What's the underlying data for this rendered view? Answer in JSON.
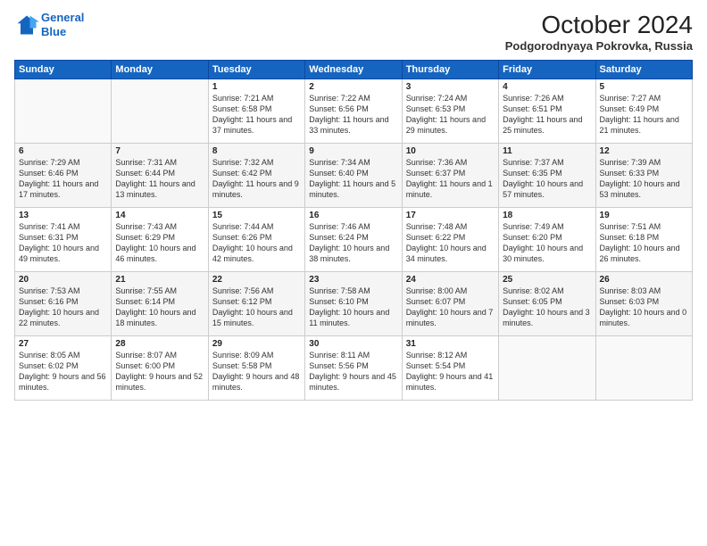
{
  "header": {
    "logo_line1": "General",
    "logo_line2": "Blue",
    "month_title": "October 2024",
    "location": "Podgorodnyaya Pokrovka, Russia"
  },
  "weekdays": [
    "Sunday",
    "Monday",
    "Tuesday",
    "Wednesday",
    "Thursday",
    "Friday",
    "Saturday"
  ],
  "weeks": [
    [
      {
        "day": "",
        "content": ""
      },
      {
        "day": "",
        "content": ""
      },
      {
        "day": "1",
        "content": "Sunrise: 7:21 AM\nSunset: 6:58 PM\nDaylight: 11 hours and 37 minutes."
      },
      {
        "day": "2",
        "content": "Sunrise: 7:22 AM\nSunset: 6:56 PM\nDaylight: 11 hours and 33 minutes."
      },
      {
        "day": "3",
        "content": "Sunrise: 7:24 AM\nSunset: 6:53 PM\nDaylight: 11 hours and 29 minutes."
      },
      {
        "day": "4",
        "content": "Sunrise: 7:26 AM\nSunset: 6:51 PM\nDaylight: 11 hours and 25 minutes."
      },
      {
        "day": "5",
        "content": "Sunrise: 7:27 AM\nSunset: 6:49 PM\nDaylight: 11 hours and 21 minutes."
      }
    ],
    [
      {
        "day": "6",
        "content": "Sunrise: 7:29 AM\nSunset: 6:46 PM\nDaylight: 11 hours and 17 minutes."
      },
      {
        "day": "7",
        "content": "Sunrise: 7:31 AM\nSunset: 6:44 PM\nDaylight: 11 hours and 13 minutes."
      },
      {
        "day": "8",
        "content": "Sunrise: 7:32 AM\nSunset: 6:42 PM\nDaylight: 11 hours and 9 minutes."
      },
      {
        "day": "9",
        "content": "Sunrise: 7:34 AM\nSunset: 6:40 PM\nDaylight: 11 hours and 5 minutes."
      },
      {
        "day": "10",
        "content": "Sunrise: 7:36 AM\nSunset: 6:37 PM\nDaylight: 11 hours and 1 minute."
      },
      {
        "day": "11",
        "content": "Sunrise: 7:37 AM\nSunset: 6:35 PM\nDaylight: 10 hours and 57 minutes."
      },
      {
        "day": "12",
        "content": "Sunrise: 7:39 AM\nSunset: 6:33 PM\nDaylight: 10 hours and 53 minutes."
      }
    ],
    [
      {
        "day": "13",
        "content": "Sunrise: 7:41 AM\nSunset: 6:31 PM\nDaylight: 10 hours and 49 minutes."
      },
      {
        "day": "14",
        "content": "Sunrise: 7:43 AM\nSunset: 6:29 PM\nDaylight: 10 hours and 46 minutes."
      },
      {
        "day": "15",
        "content": "Sunrise: 7:44 AM\nSunset: 6:26 PM\nDaylight: 10 hours and 42 minutes."
      },
      {
        "day": "16",
        "content": "Sunrise: 7:46 AM\nSunset: 6:24 PM\nDaylight: 10 hours and 38 minutes."
      },
      {
        "day": "17",
        "content": "Sunrise: 7:48 AM\nSunset: 6:22 PM\nDaylight: 10 hours and 34 minutes."
      },
      {
        "day": "18",
        "content": "Sunrise: 7:49 AM\nSunset: 6:20 PM\nDaylight: 10 hours and 30 minutes."
      },
      {
        "day": "19",
        "content": "Sunrise: 7:51 AM\nSunset: 6:18 PM\nDaylight: 10 hours and 26 minutes."
      }
    ],
    [
      {
        "day": "20",
        "content": "Sunrise: 7:53 AM\nSunset: 6:16 PM\nDaylight: 10 hours and 22 minutes."
      },
      {
        "day": "21",
        "content": "Sunrise: 7:55 AM\nSunset: 6:14 PM\nDaylight: 10 hours and 18 minutes."
      },
      {
        "day": "22",
        "content": "Sunrise: 7:56 AM\nSunset: 6:12 PM\nDaylight: 10 hours and 15 minutes."
      },
      {
        "day": "23",
        "content": "Sunrise: 7:58 AM\nSunset: 6:10 PM\nDaylight: 10 hours and 11 minutes."
      },
      {
        "day": "24",
        "content": "Sunrise: 8:00 AM\nSunset: 6:07 PM\nDaylight: 10 hours and 7 minutes."
      },
      {
        "day": "25",
        "content": "Sunrise: 8:02 AM\nSunset: 6:05 PM\nDaylight: 10 hours and 3 minutes."
      },
      {
        "day": "26",
        "content": "Sunrise: 8:03 AM\nSunset: 6:03 PM\nDaylight: 10 hours and 0 minutes."
      }
    ],
    [
      {
        "day": "27",
        "content": "Sunrise: 8:05 AM\nSunset: 6:02 PM\nDaylight: 9 hours and 56 minutes."
      },
      {
        "day": "28",
        "content": "Sunrise: 8:07 AM\nSunset: 6:00 PM\nDaylight: 9 hours and 52 minutes."
      },
      {
        "day": "29",
        "content": "Sunrise: 8:09 AM\nSunset: 5:58 PM\nDaylight: 9 hours and 48 minutes."
      },
      {
        "day": "30",
        "content": "Sunrise: 8:11 AM\nSunset: 5:56 PM\nDaylight: 9 hours and 45 minutes."
      },
      {
        "day": "31",
        "content": "Sunrise: 8:12 AM\nSunset: 5:54 PM\nDaylight: 9 hours and 41 minutes."
      },
      {
        "day": "",
        "content": ""
      },
      {
        "day": "",
        "content": ""
      }
    ]
  ]
}
